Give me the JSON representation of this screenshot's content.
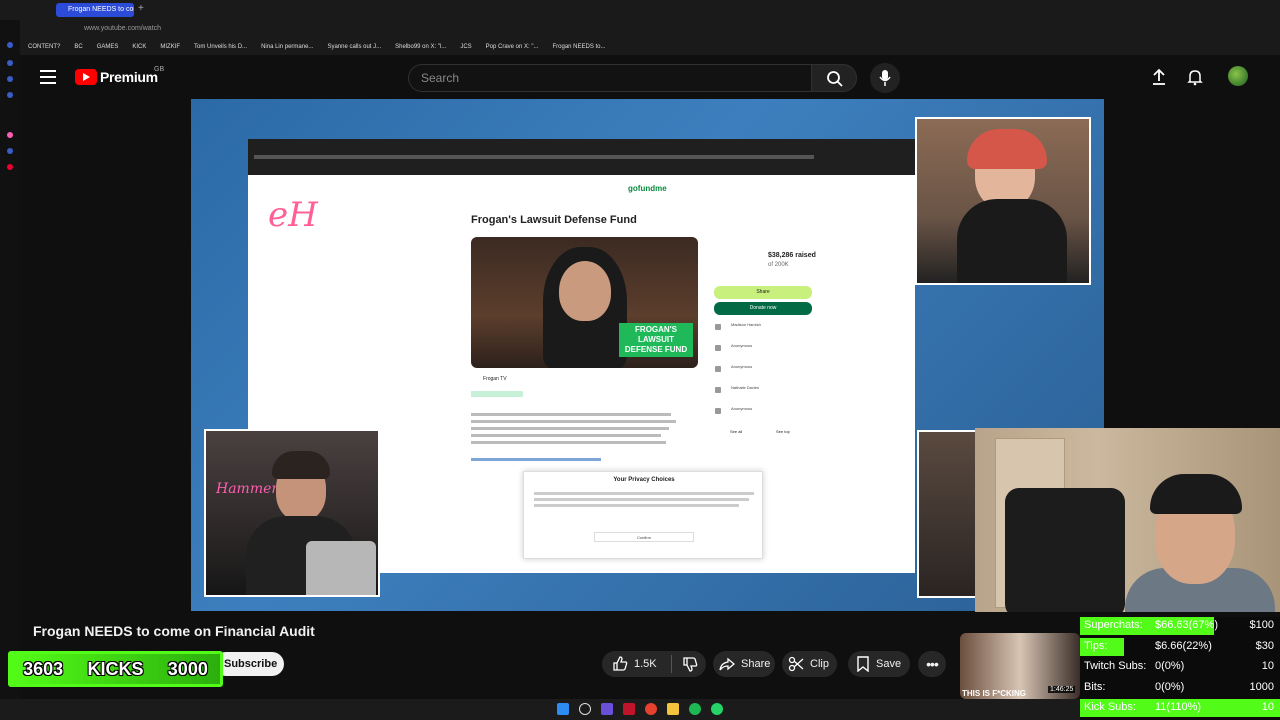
{
  "browser": {
    "tab_title": "Frogan NEEDS to com",
    "url": "www.youtube.com/watch",
    "bookmarks": [
      "CONTENT?",
      "BC",
      "GAMES",
      "KICK",
      "MIZKIF",
      "Tom Unveils his D...",
      "Nina Lin permane...",
      "Syanne calls out J...",
      "Shelbo99 on X: \"l...",
      "JCS",
      "Pop Crave on X: \"...",
      "Frogan NEEDS to..."
    ]
  },
  "header": {
    "logo_text": "Premium",
    "region": "GB",
    "search_placeholder": "Search"
  },
  "video": {
    "overlay_logo": "eH",
    "inner_page": {
      "title": "Frogan's Lawsuit Defense Fund",
      "logo": "gofundme",
      "banner": "FROGAN'S LAWSUIT DEFENSE FUND",
      "raised": "$38,286 raised",
      "of_goal": "of 200K",
      "share": "Share",
      "donate": "Donate now",
      "organizer": "Frogan TV",
      "donors": [
        "Madison Hamish",
        "Anonymous",
        "Anonymous",
        "Nathalie Davies",
        "Anonymous"
      ],
      "see_all": "See all",
      "see_top": "See top",
      "privacy_title": "Your Privacy Choices",
      "privacy_confirm": "Confirm"
    },
    "cam_overlay_text": "Hammer"
  },
  "below": {
    "title": "Frogan NEEDS to come on Financial Audit",
    "subscribe": "Subscribe",
    "likes": "1.5K",
    "share": "Share",
    "clip": "Clip",
    "save": "Save",
    "rec_text": "THIS IS F*CKING",
    "rec_duration": "1:46:25"
  },
  "kicks": {
    "current": "3603",
    "label": "KICKS",
    "goal": "3000"
  },
  "stats": [
    {
      "label": "Superchats:",
      "value": "$66.63(67%)",
      "goal": "$100",
      "progress": 0.67,
      "color": "#53fc18"
    },
    {
      "label": "Tips:",
      "value": "$6.66(22%)",
      "goal": "$30",
      "progress": 0.22,
      "color": "#53fc18"
    },
    {
      "label": "Twitch Subs:",
      "value": "0(0%)",
      "goal": "10",
      "progress": 0,
      "color": "#53fc18"
    },
    {
      "label": "Bits:",
      "value": "0(0%)",
      "goal": "1000",
      "progress": 0,
      "color": "#53fc18"
    },
    {
      "label": "Kick Subs:",
      "value": "11(110%)",
      "goal": "10",
      "progress": 1,
      "color": "#53fc18"
    }
  ]
}
